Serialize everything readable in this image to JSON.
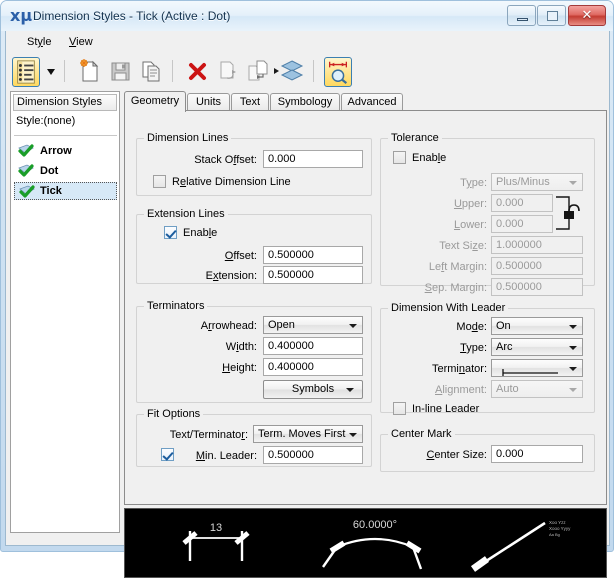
{
  "window": {
    "title": "Dimension Styles -  Tick (Active : Dot)",
    "app_icon": "microstation-icon",
    "minimize_label": "Minimize",
    "maximize_label": "Maximize",
    "close_label": "✕"
  },
  "menubar": [
    {
      "name": "menu-style",
      "prefix": "St",
      "accel": "y",
      "suffix": "le"
    },
    {
      "name": "menu-view",
      "prefix": "",
      "accel": "V",
      "suffix": "iew"
    }
  ],
  "toolbar": {
    "buttons": [
      {
        "name": "styles-list-button",
        "icon": "list-styles-icon",
        "active": true
      },
      {
        "name": "styles-dropdown-button",
        "icon": "chevron-down-icon",
        "active": false
      },
      {
        "name": "new-style-button",
        "icon": "new-document-icon",
        "active": false
      },
      {
        "name": "save-style-button",
        "icon": "save-floppy-icon",
        "active": false
      },
      {
        "name": "copy-style-button",
        "icon": "copy-pages-icon",
        "active": false
      },
      {
        "name": "delete-style-button",
        "icon": "red-x-delete-icon",
        "active": false
      },
      {
        "name": "update-style-button",
        "icon": "document-refresh-icon",
        "active": false
      },
      {
        "name": "apply-style-button",
        "icon": "document-apply-icon",
        "active": false
      },
      {
        "name": "stack-levels-button",
        "icon": "stacked-layers-icon",
        "active": false
      },
      {
        "name": "dimension-measure-button",
        "icon": "dimension-zoom-icon",
        "active": true
      }
    ]
  },
  "styles_panel": {
    "header": "Dimension Styles",
    "style_label": "Style:(none)",
    "items": [
      {
        "label": "Arrow",
        "selected": false,
        "icon": "checkmark-style-icon"
      },
      {
        "label": "Dot",
        "selected": false,
        "icon": "checkmark-style-icon"
      },
      {
        "label": "Tick",
        "selected": true,
        "icon": "checkmark-style-icon"
      }
    ]
  },
  "tabs": [
    {
      "label": "Geometry",
      "active": true
    },
    {
      "label": "Units",
      "active": false
    },
    {
      "label": "Text",
      "active": false
    },
    {
      "label": "Symbology",
      "active": false
    },
    {
      "label": "Advanced",
      "active": false
    }
  ],
  "groups": {
    "dimension_lines": {
      "title": "Dimension Lines",
      "stack_offset_label": "Stack Offset:",
      "stack_offset_value": "0.000",
      "relative_checkbox_label_pre": "R",
      "relative_checkbox_accel": "e",
      "relative_checkbox_label_post": "lative Dimension Line",
      "relative_checked": false
    },
    "extension_lines": {
      "title": "Extension Lines",
      "enable_label_pre": "Enab",
      "enable_accel": "l",
      "enable_label_post": "e",
      "enable_checked": true,
      "offset_label": "Offset:",
      "offset_value": "0.500000",
      "extension_label": "Extension:",
      "extension_value": "0.500000"
    },
    "terminators": {
      "title": "Terminators",
      "arrowhead_label": "Arrowhead:",
      "arrowhead_value": "Open",
      "width_label": "Width:",
      "width_value": "0.400000",
      "height_label": "Height:",
      "height_value": "0.400000",
      "symbols_button": "Symbols"
    },
    "fit_options": {
      "title": "Fit Options",
      "text_terminator_label": "Text/Terminator:",
      "text_terminator_value": "Term. Moves First",
      "min_leader_checked": true,
      "min_leader_label": "Min. Leader:",
      "min_leader_value": "0.500000"
    },
    "tolerance": {
      "title": "Tolerance",
      "enable_label_pre": "Enab",
      "enable_accel": "l",
      "enable_label_post": "e",
      "enable_checked": false,
      "type_label": "Type:",
      "type_value": "Plus/Minus",
      "upper_label": "Upper:",
      "upper_value": "0.000",
      "lower_label": "Lower:",
      "lower_value": "0.000",
      "text_size_label": "Text Size:",
      "text_size_value": "1.000000",
      "left_margin_label": "Left Margin:",
      "left_margin_value": "0.500000",
      "sep_margin_label": "Sep. Margin:",
      "sep_margin_value": "0.500000",
      "link_icon": "padlock-link-icon",
      "disabled": true
    },
    "dimension_with_leader": {
      "title": "Dimension With Leader",
      "mode_label": "Mode:",
      "mode_value": "On",
      "type_label": "Type:",
      "type_value": "Arc",
      "terminator_label": "Terminator:",
      "terminator_value": "line-terminator-symbol",
      "alignment_label": "Alignment:",
      "alignment_value": "Auto",
      "alignment_disabled": true,
      "inline_leader_label": "In-line Leader",
      "inline_leader_checked": false
    },
    "center_mark": {
      "title": "Center Mark",
      "center_size_label": "Center Size:",
      "center_size_value": "0.000"
    }
  },
  "preview": {
    "linear_value": "13",
    "angular_value": "60.0000°",
    "leader_text_line1": "Xoo Yzz",
    "leader_text_line2": "Xooo Yyyy",
    "leader_text_line3": "Aa Bg",
    "background": "#000000",
    "stroke": "#ffffff"
  }
}
